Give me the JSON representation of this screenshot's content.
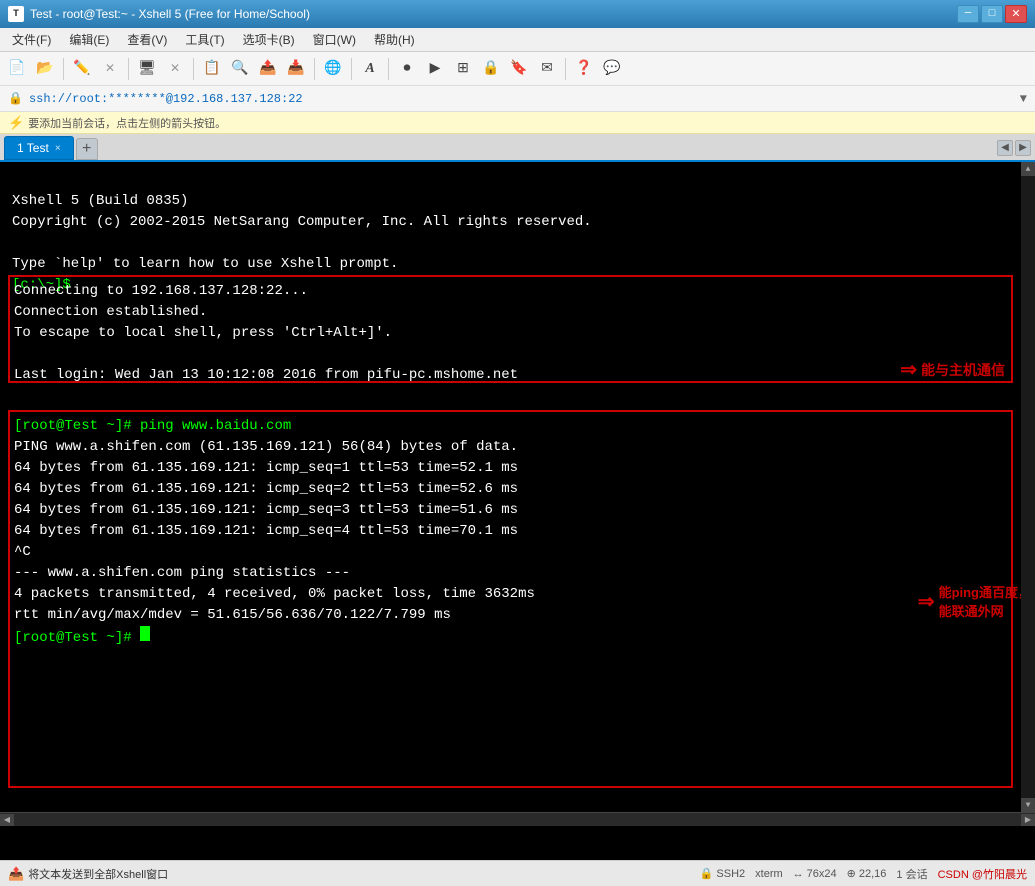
{
  "titlebar": {
    "icon": "T",
    "title": "Test - root@Test:~ - Xshell 5 (Free for Home/School)",
    "btn_min": "─",
    "btn_max": "□",
    "btn_close": "✕"
  },
  "menubar": {
    "items": [
      {
        "label": "文件(F)"
      },
      {
        "label": "编辑(E)"
      },
      {
        "label": "查看(V)"
      },
      {
        "label": "工具(T)"
      },
      {
        "label": "选项卡(B)"
      },
      {
        "label": "窗口(W)"
      },
      {
        "label": "帮助(H)"
      }
    ]
  },
  "addressbar": {
    "url": "ssh://root:********@192.168.137.128:22"
  },
  "infobar": {
    "text": "要添加当前会话，点击左侧的箭头按钮。"
  },
  "tabbar": {
    "active_tab": "1 Test",
    "tab_close": "×",
    "tab_add": "+"
  },
  "terminal": {
    "line1": "Xshell 5 (Build 0835)",
    "line2": "Copyright (c) 2002-2015 NetSarang Computer, Inc. All rights reserved.",
    "line3": "",
    "line4": "Type `help' to learn how to use Xshell prompt.",
    "prompt1": "[c:\\~]$ ",
    "line5": "",
    "connect1": "Connecting to 192.168.137.128:22...",
    "connect2": "Connection established.",
    "connect3": "To escape to local shell, press 'Ctrl+Alt+]'.",
    "connect4": "",
    "connect5": "Last login: Wed Jan 13 10:12:08 2016 from pifu-pc.mshome.net",
    "prompt2": "[root@Test ~]# ping www.baidu.com",
    "ping1": "PING www.a.shifen.com (61.135.169.121) 56(84) bytes of data.",
    "ping2": "64 bytes from 61.135.169.121: icmp_seq=1 ttl=53 time=52.1 ms",
    "ping3": "64 bytes from 61.135.169.121: icmp_seq=2 ttl=53 time=52.6 ms",
    "ping4": "64 bytes from 61.135.169.121: icmp_seq=3 ttl=53 time=51.6 ms",
    "ping5": "64 bytes from 61.135.169.121: icmp_seq=4 ttl=53 time=70.1 ms",
    "ping6": "^C",
    "ping7": "--- www.a.shifen.com ping statistics ---",
    "ping8": "4 packets transmitted, 4 received, 0% packet loss, time 3632ms",
    "ping9": "rtt min/avg/max/mdev = 51.615/56.636/70.122/7.799 ms",
    "prompt3": "[root@Test ~]# "
  },
  "annotations": {
    "annotation1": "能与主机通信",
    "annotation2": "能ping通百度，\n能联通外网"
  },
  "statusbar": {
    "send_text": "将文本发送到全部Xshell窗口",
    "ssh": "SSH2",
    "term": "xterm",
    "rows": "76x24",
    "pos": "22,16",
    "sessions": "1 会话",
    "brand": "CSDN @竹阳晨光"
  }
}
